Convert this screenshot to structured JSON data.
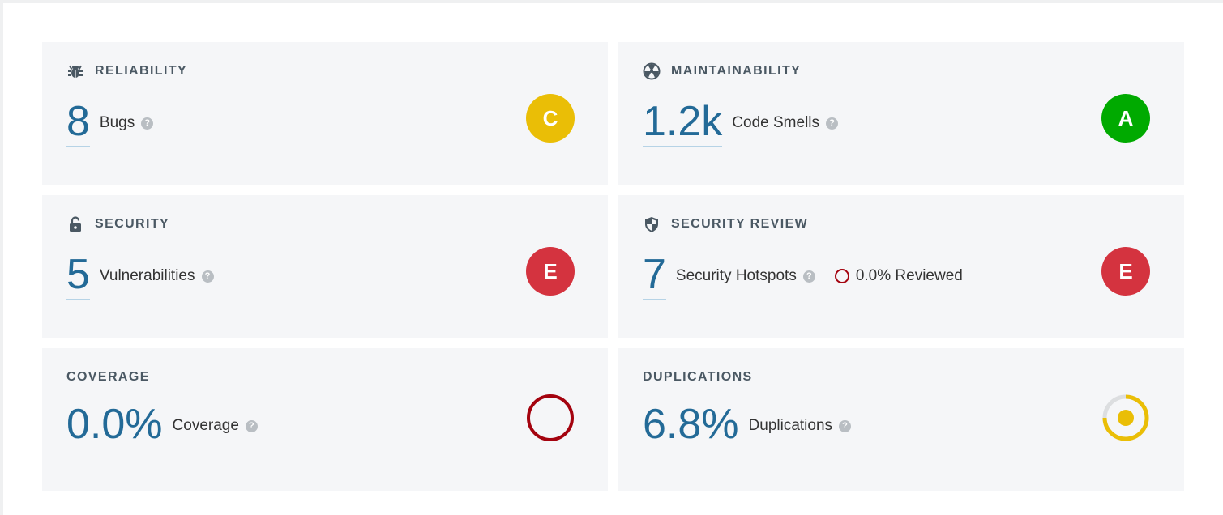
{
  "cards": {
    "reliability": {
      "title": "RELIABILITY",
      "icon": "bug-icon",
      "value": "8",
      "label": "Bugs",
      "rating": "C",
      "rating_color": "#eabe06"
    },
    "maintainability": {
      "title": "MAINTAINABILITY",
      "icon": "radiation-icon",
      "value": "1.2k",
      "label": "Code Smells",
      "rating": "A",
      "rating_color": "#00aa00"
    },
    "security": {
      "title": "SECURITY",
      "icon": "unlock-icon",
      "value": "5",
      "label": "Vulnerabilities",
      "rating": "E",
      "rating_color": "#d4333f"
    },
    "security_review": {
      "title": "SECURITY REVIEW",
      "icon": "shield-icon",
      "value": "7",
      "label": "Security Hotspots",
      "reviewed": "0.0% Reviewed",
      "rating": "E",
      "rating_color": "#d4333f"
    },
    "coverage": {
      "title": "COVERAGE",
      "value": "0.0%",
      "label": "Coverage",
      "coverage_percent": 0.0,
      "ring_color": "#a4030f"
    },
    "duplications": {
      "title": "DUPLICATIONS",
      "value": "6.8%",
      "label": "Duplications",
      "duplication_percent": 6.8,
      "ring_color": "#eabe06"
    }
  },
  "help_glyph": "?"
}
